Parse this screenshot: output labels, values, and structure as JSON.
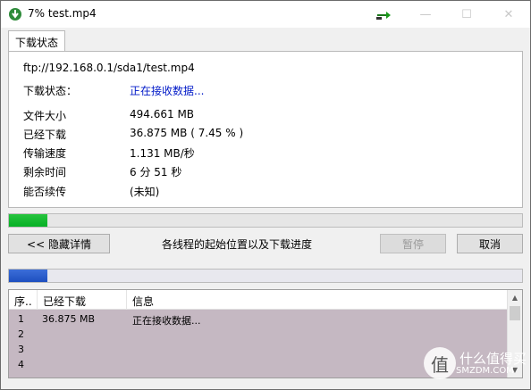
{
  "window": {
    "title": "7% test.mp4"
  },
  "tab": {
    "label": "下载状态"
  },
  "details": {
    "url": "ftp://192.168.0.1/sda1/test.mp4",
    "status_label": "下载状态：",
    "status_value": "正在接收数据...",
    "rows": [
      {
        "label": "文件大小",
        "value": "494.661  MB"
      },
      {
        "label": "已经下载",
        "value": "36.875  MB  ( 7.45 % )"
      },
      {
        "label": "传输速度",
        "value": "1.131  MB/秒"
      },
      {
        "label": "剩余时间",
        "value": "6 分 51 秒"
      },
      {
        "label": "能否续传",
        "value": "(未知)"
      }
    ]
  },
  "progress": {
    "overall_fraction": 0.0745,
    "thread_fraction": 0.0745
  },
  "buttons": {
    "hide_details": "<< 隐藏详情",
    "pause": "暂停",
    "cancel": "取消"
  },
  "threads_label": "各线程的起始位置以及下载进度",
  "list": {
    "columns": [
      "序..",
      "已经下载",
      "信息"
    ],
    "rows": [
      {
        "index": "1",
        "downloaded": "36.875  MB",
        "info": "正在接收数据..."
      },
      {
        "index": "2",
        "downloaded": "",
        "info": ""
      },
      {
        "index": "3",
        "downloaded": "",
        "info": ""
      },
      {
        "index": "4",
        "downloaded": "",
        "info": ""
      }
    ]
  },
  "watermark": {
    "text": "什么值得买",
    "sub": "SMZDM.COM"
  },
  "colors": {
    "status_blue": "#0019c8",
    "progress_green": "#06b025",
    "thread_blue": "#1e4fbf",
    "list_bg": "#c5b8c2"
  }
}
